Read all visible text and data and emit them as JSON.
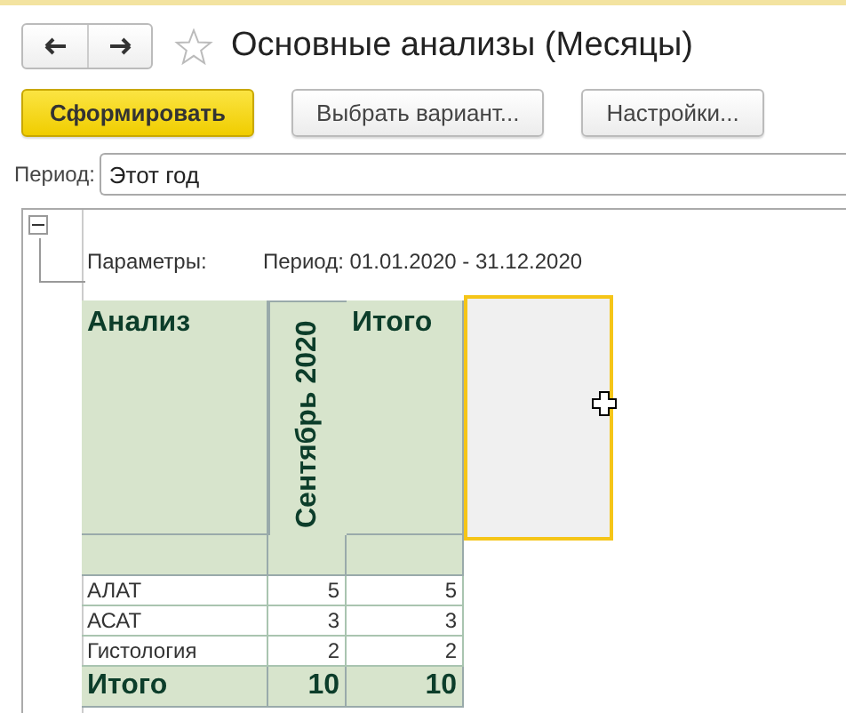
{
  "window": {
    "title": "Основные анализы (Месяцы)",
    "favorite": false
  },
  "toolbar": {
    "buttons": [
      {
        "label": "Сформировать",
        "kind": "primary"
      },
      {
        "label": "Выбрать вариант...",
        "kind": "normal"
      },
      {
        "label": "Настройки...",
        "kind": "normal"
      }
    ]
  },
  "period": {
    "label": "Период:",
    "value": "Этот год"
  },
  "report": {
    "group_expanded": true,
    "parameters_label": "Параметры:",
    "parameters_value": "Период: 01.01.2020 - 31.12.2020",
    "table": {
      "columns": [
        "Анализ",
        "Сентябрь 2020",
        "Итого"
      ],
      "rows": [
        {
          "cells": [
            "АЛАТ",
            "5",
            "5"
          ]
        },
        {
          "cells": [
            "АСАТ",
            "3",
            "3"
          ]
        },
        {
          "cells": [
            "Гистология",
            "2",
            "2"
          ]
        }
      ],
      "total": [
        "Итого",
        "10",
        "10"
      ],
      "empty_cell_selected": true
    }
  }
}
